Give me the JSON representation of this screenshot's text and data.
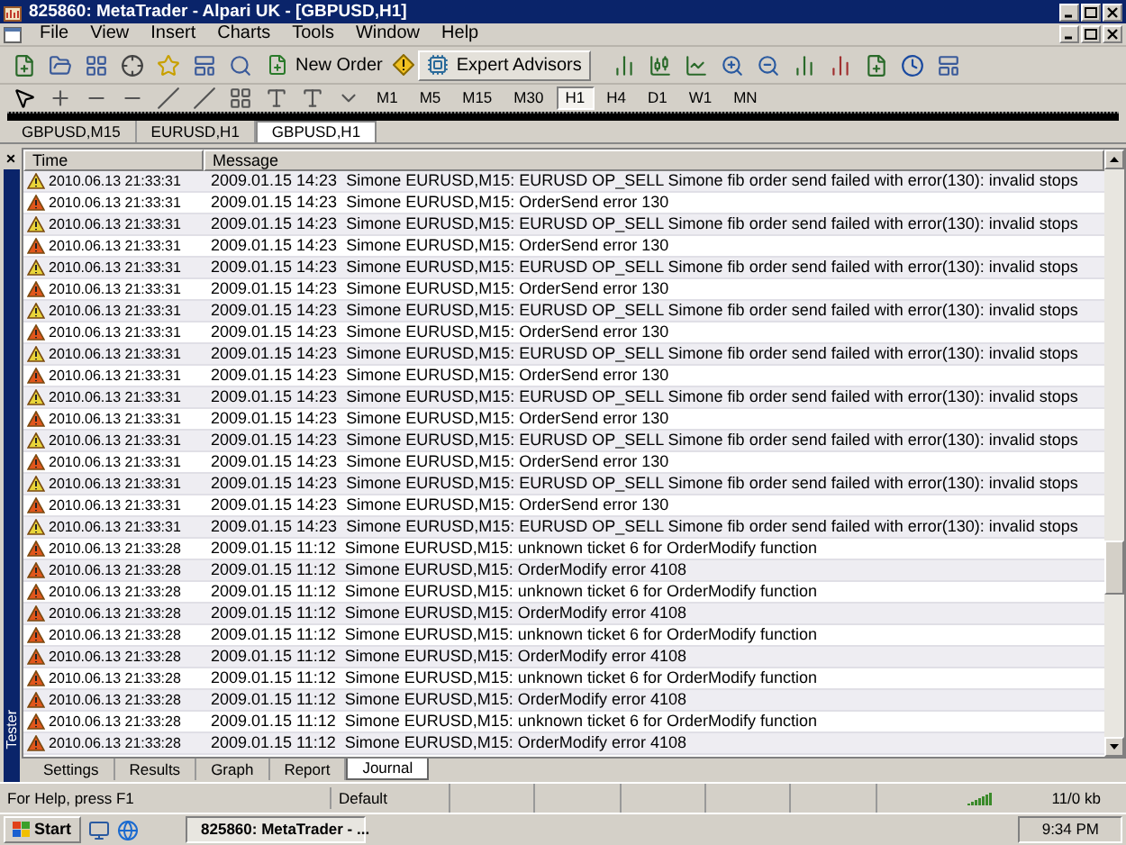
{
  "window": {
    "title": "825860: MetaTrader - Alpari UK - [GBPUSD,H1]"
  },
  "menu": [
    "File",
    "View",
    "Insert",
    "Charts",
    "Tools",
    "Window",
    "Help"
  ],
  "toolbar": {
    "new_order": "New Order",
    "expert_advisors": "Expert Advisors"
  },
  "timeframes": [
    {
      "label": "M1",
      "selected": false
    },
    {
      "label": "M5",
      "selected": false
    },
    {
      "label": "M15",
      "selected": false
    },
    {
      "label": "M30",
      "selected": false
    },
    {
      "label": "H1",
      "selected": true
    },
    {
      "label": "H4",
      "selected": false
    },
    {
      "label": "D1",
      "selected": false
    },
    {
      "label": "W1",
      "selected": false
    },
    {
      "label": "MN",
      "selected": false
    }
  ],
  "chart_tabs": [
    {
      "label": "GBPUSD,M15",
      "selected": false
    },
    {
      "label": "EURUSD,H1",
      "selected": false
    },
    {
      "label": "GBPUSD,H1",
      "selected": true
    }
  ],
  "terminal": {
    "side_label": "Tester",
    "close": "×",
    "columns": [
      "Time",
      "Message"
    ],
    "rows": [
      {
        "kind": "warning",
        "time": "2010.06.13 21:33:31",
        "message": "2009.01.15 14:23  Simone EURUSD,M15: EURUSD OP_SELL Simone fib order send failed with error(130): invalid stops"
      },
      {
        "kind": "error",
        "time": "2010.06.13 21:33:31",
        "message": "2009.01.15 14:23  Simone EURUSD,M15: OrderSend error 130"
      },
      {
        "kind": "warning",
        "time": "2010.06.13 21:33:31",
        "message": "2009.01.15 14:23  Simone EURUSD,M15: EURUSD OP_SELL Simone fib order send failed with error(130): invalid stops"
      },
      {
        "kind": "error",
        "time": "2010.06.13 21:33:31",
        "message": "2009.01.15 14:23  Simone EURUSD,M15: OrderSend error 130"
      },
      {
        "kind": "warning",
        "time": "2010.06.13 21:33:31",
        "message": "2009.01.15 14:23  Simone EURUSD,M15: EURUSD OP_SELL Simone fib order send failed with error(130): invalid stops"
      },
      {
        "kind": "error",
        "time": "2010.06.13 21:33:31",
        "message": "2009.01.15 14:23  Simone EURUSD,M15: OrderSend error 130"
      },
      {
        "kind": "warning",
        "time": "2010.06.13 21:33:31",
        "message": "2009.01.15 14:23  Simone EURUSD,M15: EURUSD OP_SELL Simone fib order send failed with error(130): invalid stops"
      },
      {
        "kind": "error",
        "time": "2010.06.13 21:33:31",
        "message": "2009.01.15 14:23  Simone EURUSD,M15: OrderSend error 130"
      },
      {
        "kind": "warning",
        "time": "2010.06.13 21:33:31",
        "message": "2009.01.15 14:23  Simone EURUSD,M15: EURUSD OP_SELL Simone fib order send failed with error(130): invalid stops"
      },
      {
        "kind": "error",
        "time": "2010.06.13 21:33:31",
        "message": "2009.01.15 14:23  Simone EURUSD,M15: OrderSend error 130"
      },
      {
        "kind": "warning",
        "time": "2010.06.13 21:33:31",
        "message": "2009.01.15 14:23  Simone EURUSD,M15: EURUSD OP_SELL Simone fib order send failed with error(130): invalid stops"
      },
      {
        "kind": "error",
        "time": "2010.06.13 21:33:31",
        "message": "2009.01.15 14:23  Simone EURUSD,M15: OrderSend error 130"
      },
      {
        "kind": "warning",
        "time": "2010.06.13 21:33:31",
        "message": "2009.01.15 14:23  Simone EURUSD,M15: EURUSD OP_SELL Simone fib order send failed with error(130): invalid stops"
      },
      {
        "kind": "error",
        "time": "2010.06.13 21:33:31",
        "message": "2009.01.15 14:23  Simone EURUSD,M15: OrderSend error 130"
      },
      {
        "kind": "warning",
        "time": "2010.06.13 21:33:31",
        "message": "2009.01.15 14:23  Simone EURUSD,M15: EURUSD OP_SELL Simone fib order send failed with error(130): invalid stops"
      },
      {
        "kind": "error",
        "time": "2010.06.13 21:33:31",
        "message": "2009.01.15 14:23  Simone EURUSD,M15: OrderSend error 130"
      },
      {
        "kind": "warning",
        "time": "2010.06.13 21:33:31",
        "message": "2009.01.15 14:23  Simone EURUSD,M15: EURUSD OP_SELL Simone fib order send failed with error(130): invalid stops"
      },
      {
        "kind": "error",
        "time": "2010.06.13 21:33:28",
        "message": "2009.01.15 11:12  Simone EURUSD,M15: unknown ticket 6 for OrderModify function"
      },
      {
        "kind": "error",
        "time": "2010.06.13 21:33:28",
        "message": "2009.01.15 11:12  Simone EURUSD,M15: OrderModify error 4108"
      },
      {
        "kind": "error",
        "time": "2010.06.13 21:33:28",
        "message": "2009.01.15 11:12  Simone EURUSD,M15: unknown ticket 6 for OrderModify function"
      },
      {
        "kind": "error",
        "time": "2010.06.13 21:33:28",
        "message": "2009.01.15 11:12  Simone EURUSD,M15: OrderModify error 4108"
      },
      {
        "kind": "error",
        "time": "2010.06.13 21:33:28",
        "message": "2009.01.15 11:12  Simone EURUSD,M15: unknown ticket 6 for OrderModify function"
      },
      {
        "kind": "error",
        "time": "2010.06.13 21:33:28",
        "message": "2009.01.15 11:12  Simone EURUSD,M15: OrderModify error 4108"
      },
      {
        "kind": "error",
        "time": "2010.06.13 21:33:28",
        "message": "2009.01.15 11:12  Simone EURUSD,M15: unknown ticket 6 for OrderModify function"
      },
      {
        "kind": "error",
        "time": "2010.06.13 21:33:28",
        "message": "2009.01.15 11:12  Simone EURUSD,M15: OrderModify error 4108"
      },
      {
        "kind": "error",
        "time": "2010.06.13 21:33:28",
        "message": "2009.01.15 11:12  Simone EURUSD,M15: unknown ticket 6 for OrderModify function"
      },
      {
        "kind": "error",
        "time": "2010.06.13 21:33:28",
        "message": "2009.01.15 11:12  Simone EURUSD,M15: OrderModify error 4108"
      }
    ],
    "tabs": [
      {
        "label": "Settings",
        "selected": false
      },
      {
        "label": "Results",
        "selected": false
      },
      {
        "label": "Graph",
        "selected": false
      },
      {
        "label": "Report",
        "selected": false
      },
      {
        "label": "Journal",
        "selected": true
      }
    ]
  },
  "status_bar": {
    "help": "For Help, press F1",
    "profile": "Default",
    "traffic": "11/0 kb"
  },
  "taskbar": {
    "start": "Start",
    "task": "825860: MetaTrader - ...",
    "clock": "9:34 PM"
  }
}
